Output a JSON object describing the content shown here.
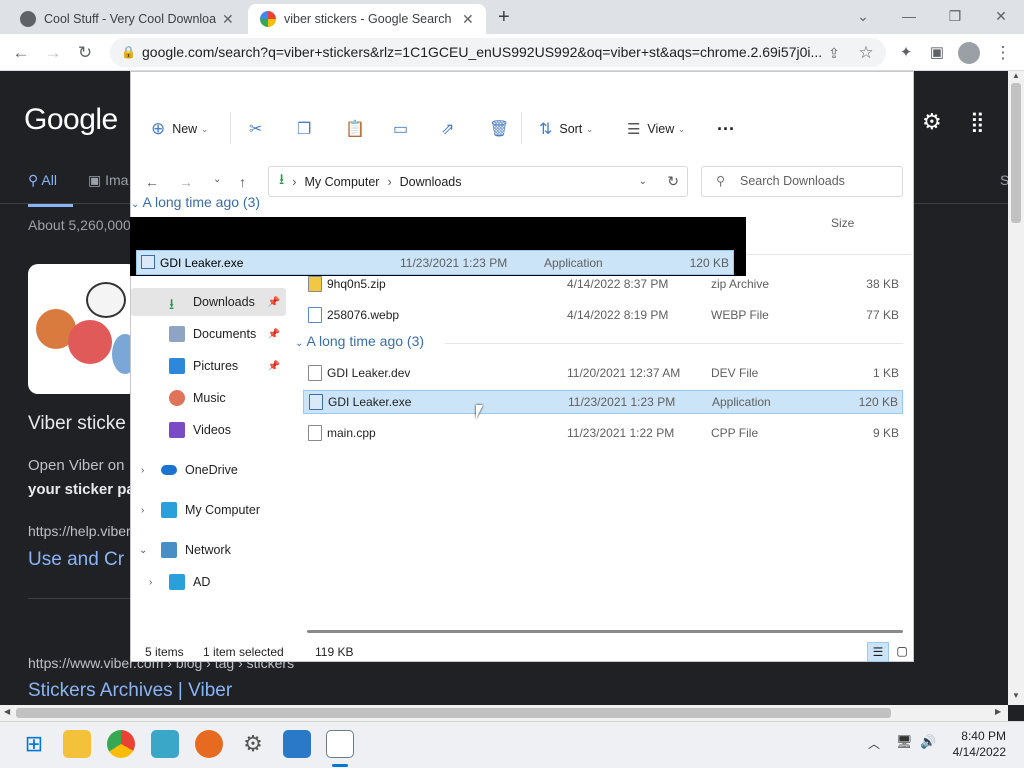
{
  "browser": {
    "tabs": [
      {
        "title": "Cool Stuff - Very Cool Download",
        "active": false
      },
      {
        "title": "viber stickers - Google Search",
        "active": true
      }
    ],
    "url": "google.com/search?q=viber+stickers&rlz=1C1GCEU_enUS992US992&oq=viber+st&aqs=chrome.2.69i57j0i..."
  },
  "google": {
    "logo": "Google",
    "tab_all": "All",
    "tab_images": "Ima",
    "tab_s": "S",
    "result_count": "About 5,260,000",
    "snippet_title": "Viber sticke",
    "snippet_line1": "Open Viber on",
    "snippet_line2": "your sticker pa",
    "url1": "https://help.viber",
    "link1": "Use and Cr",
    "url2": "https://www.viber.com › blog › tag › stickers",
    "link2": "Stickers Archives | Viber"
  },
  "explorer": {
    "toolbar": {
      "new": "New",
      "sort": "Sort",
      "view": "View"
    },
    "breadcrumb": [
      "My Computer",
      "Downloads"
    ],
    "search_placeholder": "Search Downloads",
    "column_size": "Size",
    "group_top": "A long time ago (3)",
    "nav": [
      {
        "label": "Downloads",
        "pinned": true,
        "selected": true
      },
      {
        "label": "Documents",
        "pinned": true
      },
      {
        "label": "Pictures",
        "pinned": true
      },
      {
        "label": "Music"
      },
      {
        "label": "Videos"
      },
      {
        "label": "OneDrive"
      },
      {
        "label": "My Computer"
      },
      {
        "label": "Network"
      },
      {
        "label": "AD"
      }
    ],
    "recent_files": [
      {
        "name": "9hq0n5.zip",
        "date": "4/14/2022 8:37 PM",
        "type": "zip Archive",
        "size": "38 KB"
      },
      {
        "name": "258076.webp",
        "date": "4/14/2022 8:19 PM",
        "type": "WEBP File",
        "size": "77 KB"
      }
    ],
    "group_old": "A long time ago (3)",
    "old_files": [
      {
        "name": "GDI Leaker.dev",
        "date": "11/20/2021 12:37 AM",
        "type": "DEV File",
        "size": "1 KB"
      },
      {
        "name": "GDI Leaker.exe",
        "date": "11/23/2021 1:23 PM",
        "type": "Application",
        "size": "120 KB",
        "selected": true
      },
      {
        "name": "main.cpp",
        "date": "11/23/2021 1:22 PM",
        "type": "CPP File",
        "size": "9 KB"
      }
    ],
    "drag_row": {
      "name": "GDI Leaker.exe",
      "date": "11/23/2021 1:23 PM",
      "type": "Application",
      "size": "120 KB"
    },
    "status_items": "5 items",
    "status_selected": "1 item selected",
    "status_size": "119 KB"
  },
  "taskbar": {
    "time": "8:40 PM",
    "date": "4/14/2022"
  },
  "colors": {
    "accent": "#0078d4",
    "google_link": "#8ab4f8",
    "selection": "#cce4f7"
  }
}
